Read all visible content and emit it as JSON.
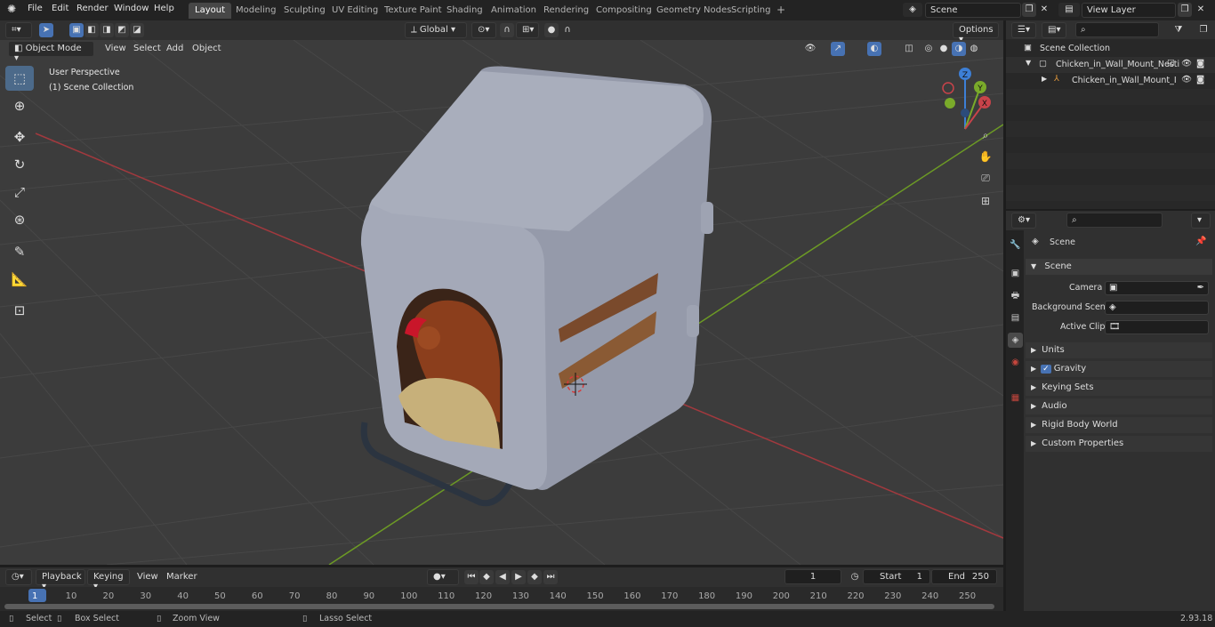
{
  "topbar": {
    "menus": [
      "File",
      "Edit",
      "Render",
      "Window",
      "Help"
    ],
    "workspaces": [
      "Layout",
      "Modeling",
      "Sculpting",
      "UV Editing",
      "Texture Paint",
      "Shading",
      "Animation",
      "Rendering",
      "Compositing",
      "Geometry Nodes",
      "Scripting"
    ],
    "active_workspace": "Layout",
    "scene": "Scene",
    "view_layer": "View Layer",
    "add_tab": "+"
  },
  "viewport_header": {
    "mode": "Object Mode",
    "menus": [
      "View",
      "Select",
      "Add",
      "Object"
    ],
    "orientation": "Global",
    "options": "Options"
  },
  "viewport": {
    "perspective": "User Perspective",
    "collection": "(1) Scene Collection",
    "gizmo_axes": [
      "Z",
      "Y",
      "X"
    ]
  },
  "outliner": {
    "root": "Scene Collection",
    "items": [
      {
        "label": "Chicken_in_Wall_Mount_Nesti"
      },
      {
        "label": "Chicken_in_Wall_Mount_I"
      }
    ]
  },
  "properties": {
    "title": "Scene",
    "section": "Scene",
    "fields": [
      {
        "label": "Camera",
        "value": ""
      },
      {
        "label": "Background Scene",
        "value": ""
      },
      {
        "label": "Active Clip",
        "value": ""
      }
    ],
    "panels": [
      "Units",
      "Gravity",
      "Keying Sets",
      "Audio",
      "Rigid Body World",
      "Custom Properties"
    ]
  },
  "timeline": {
    "menus": [
      "Playback",
      "Keying",
      "View",
      "Marker"
    ],
    "current_frame": "1",
    "start_label": "Start",
    "start": "1",
    "end_label": "End",
    "end": "250",
    "ticks": [
      "1",
      "10",
      "20",
      "30",
      "40",
      "50",
      "60",
      "70",
      "80",
      "90",
      "100",
      "110",
      "120",
      "130",
      "140",
      "150",
      "160",
      "170",
      "180",
      "190",
      "200",
      "210",
      "220",
      "230",
      "240",
      "250"
    ]
  },
  "status": {
    "select": "Select",
    "box_select": "Box Select",
    "zoom_view": "Zoom View",
    "lasso_select": "Lasso Select",
    "version": "2.93.18"
  },
  "colors": {
    "accent": "#4772b3",
    "x_axis": "#c8434a",
    "y_axis": "#7aaa2a",
    "z_axis": "#3d7fd6",
    "nest_box": "#a4a9b8"
  }
}
